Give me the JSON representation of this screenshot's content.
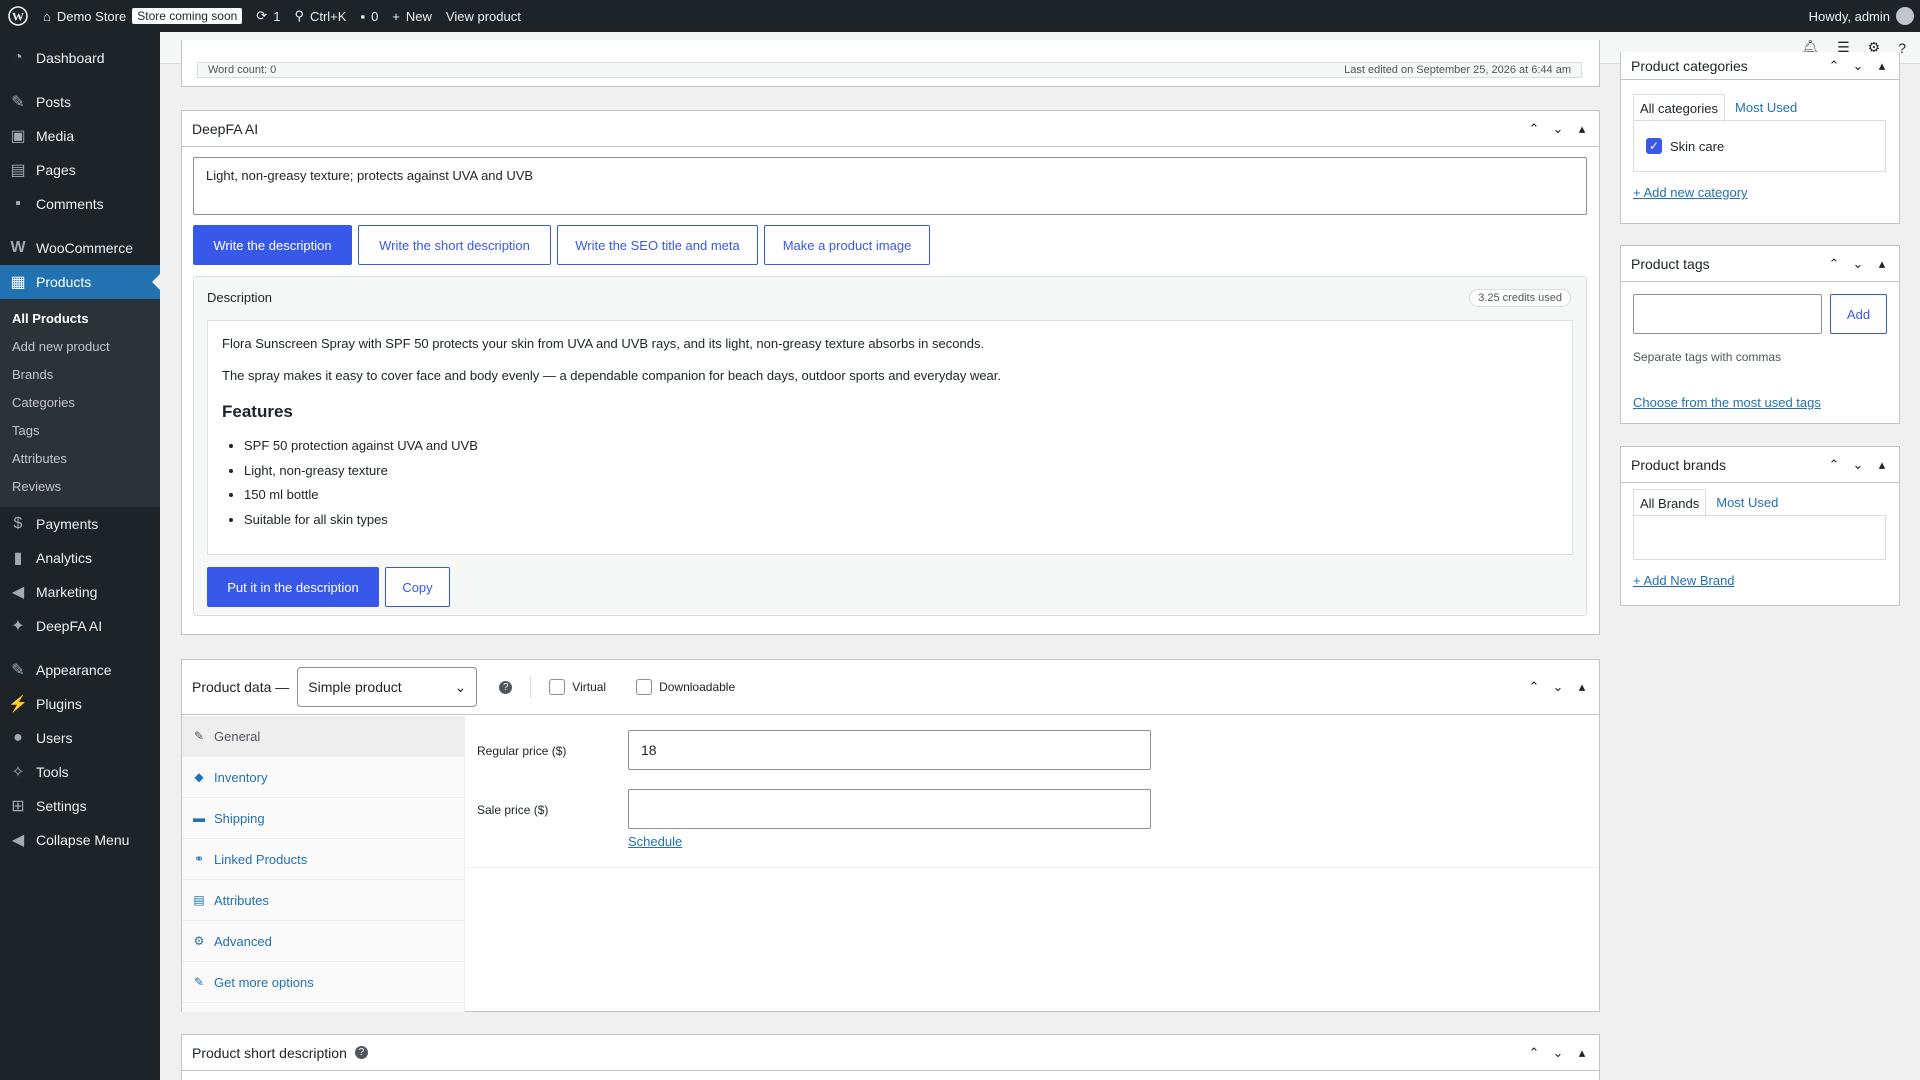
{
  "adminbar": {
    "site_name": "Demo Store",
    "store_badge": "Store coming soon",
    "updates_count": "1",
    "search_shortcut": "Ctrl+K",
    "comments_count": "0",
    "new_label": "New",
    "view_product": "View product",
    "howdy": "Howdy, admin"
  },
  "sidebar": {
    "dashboard": "Dashboard",
    "posts": "Posts",
    "media": "Media",
    "pages": "Pages",
    "comments": "Comments",
    "woocommerce": "WooCommerce",
    "products": "Products",
    "submenu": [
      "All Products",
      "Add new product",
      "Brands",
      "Categories",
      "Tags",
      "Attributes",
      "Reviews"
    ],
    "payments": "Payments",
    "analytics": "Analytics",
    "marketing": "Marketing",
    "deepfa": "DeepFA AI",
    "appearance": "Appearance",
    "plugins": "Plugins",
    "users": "Users",
    "tools": "Tools",
    "settings": "Settings",
    "collapse": "Collapse Menu"
  },
  "editor_status": {
    "word_count": "Word count: 0",
    "last_edited": "Last edited on September 25, 2026 at 6:44 am"
  },
  "deepfa": {
    "title": "DeepFA AI",
    "prompt_value": "Light, non-greasy texture; protects against UVA and UVB",
    "buttons": [
      "Write the description",
      "Write the short description",
      "Write the SEO title and meta",
      "Make a product image"
    ],
    "result_label": "Description",
    "credits": "3.25 credits used",
    "para1": "Flora Sunscreen Spray with SPF 50 protects your skin from UVA and UVB rays, and its light, non-greasy texture absorbs in seconds.",
    "para2": "The spray makes it easy to cover face and body evenly — a dependable companion for beach days, outdoor sports and everyday wear.",
    "features_heading": "Features",
    "features": [
      "SPF 50 protection against UVA and UVB",
      "Light, non-greasy texture",
      "150 ml bottle",
      "Suitable for all skin types"
    ],
    "put_button": "Put it in the description",
    "copy_button": "Copy"
  },
  "product_data": {
    "title": "Product data —",
    "type_value": "Simple product",
    "virtual_label": "Virtual",
    "downloadable_label": "Downloadable",
    "tabs": [
      "General",
      "Inventory",
      "Shipping",
      "Linked Products",
      "Attributes",
      "Advanced",
      "Get more options"
    ],
    "regular_price_label": "Regular price ($)",
    "regular_price_value": "18",
    "sale_price_label": "Sale price ($)",
    "sale_price_value": "",
    "schedule_link": "Schedule"
  },
  "short_description": {
    "title": "Product short description"
  },
  "categories": {
    "title": "Product categories",
    "tab_all": "All categories",
    "tab_most_used": "Most Used",
    "items": [
      {
        "label": "Skin care",
        "checked": true
      }
    ],
    "add_link": "+ Add new category"
  },
  "tags": {
    "title": "Product tags",
    "input_value": "",
    "add_button": "Add",
    "hint": "Separate tags with commas",
    "choose_link": "Choose from the most used tags"
  },
  "brands": {
    "title": "Product brands",
    "tab_all": "All Brands",
    "tab_most_used": "Most Used",
    "add_link": "+ Add New Brand"
  },
  "colors": {
    "accent": "#3858e9",
    "admin_bg": "#1d2327",
    "active_menu": "#2271b1"
  }
}
